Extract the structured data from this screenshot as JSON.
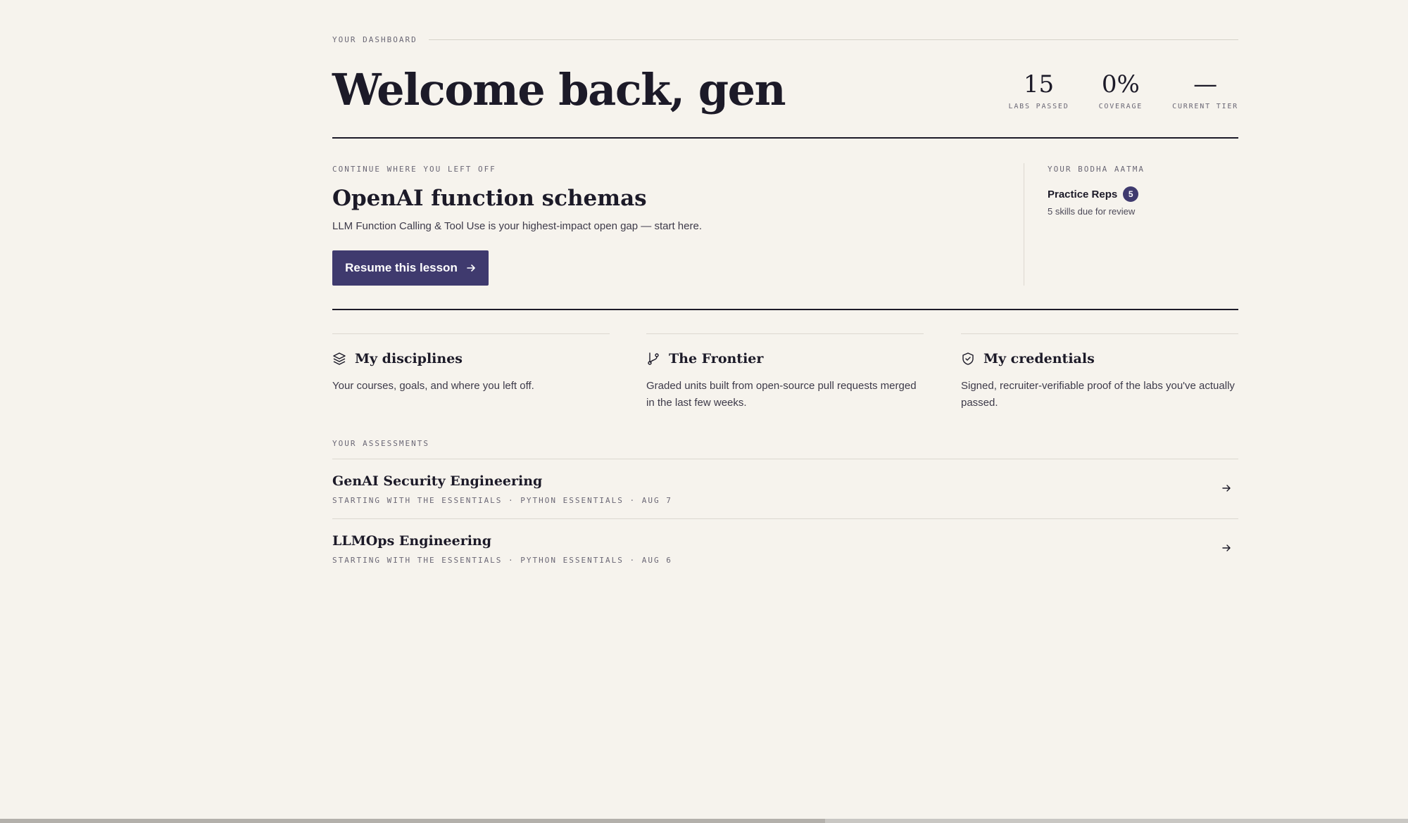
{
  "header": {
    "eyebrow": "YOUR DASHBOARD",
    "welcome": "Welcome back, gen",
    "stats": [
      {
        "value": "15",
        "label": "LABS PASSED"
      },
      {
        "value": "0%",
        "label": "COVERAGE"
      },
      {
        "value": "—",
        "label": "CURRENT TIER"
      }
    ]
  },
  "continue": {
    "label": "CONTINUE WHERE YOU LEFT OFF",
    "title": "OpenAI function schemas",
    "description": "LLM Function Calling & Tool Use is your highest-impact open gap — start here.",
    "button_label": "Resume this lesson"
  },
  "aatma": {
    "label": "YOUR BODHA AATMA",
    "reps_title": "Practice Reps",
    "reps_count": "5",
    "reps_sub": "5 skills due for review"
  },
  "features": [
    {
      "icon": "layers-icon",
      "title": "My disciplines",
      "description": "Your courses, goals, and where you left off."
    },
    {
      "icon": "git-branch-icon",
      "title": "The Frontier",
      "description": "Graded units built from open-source pull requests merged in the last few weeks."
    },
    {
      "icon": "shield-check-icon",
      "title": "My credentials",
      "description": "Signed, recruiter-verifiable proof of the labs you've actually passed."
    }
  ],
  "assessments": {
    "label": "YOUR ASSESSMENTS",
    "items": [
      {
        "title": "GenAI Security Engineering",
        "meta": "STARTING WITH THE ESSENTIALS · PYTHON ESSENTIALS · AUG 7"
      },
      {
        "title": "LLMOps Engineering",
        "meta": "STARTING WITH THE ESSENTIALS · PYTHON ESSENTIALS · AUG 6"
      }
    ]
  },
  "colors": {
    "background": "#f6f3ed",
    "accent": "#3f3a6e",
    "ink": "#1c1a28"
  }
}
